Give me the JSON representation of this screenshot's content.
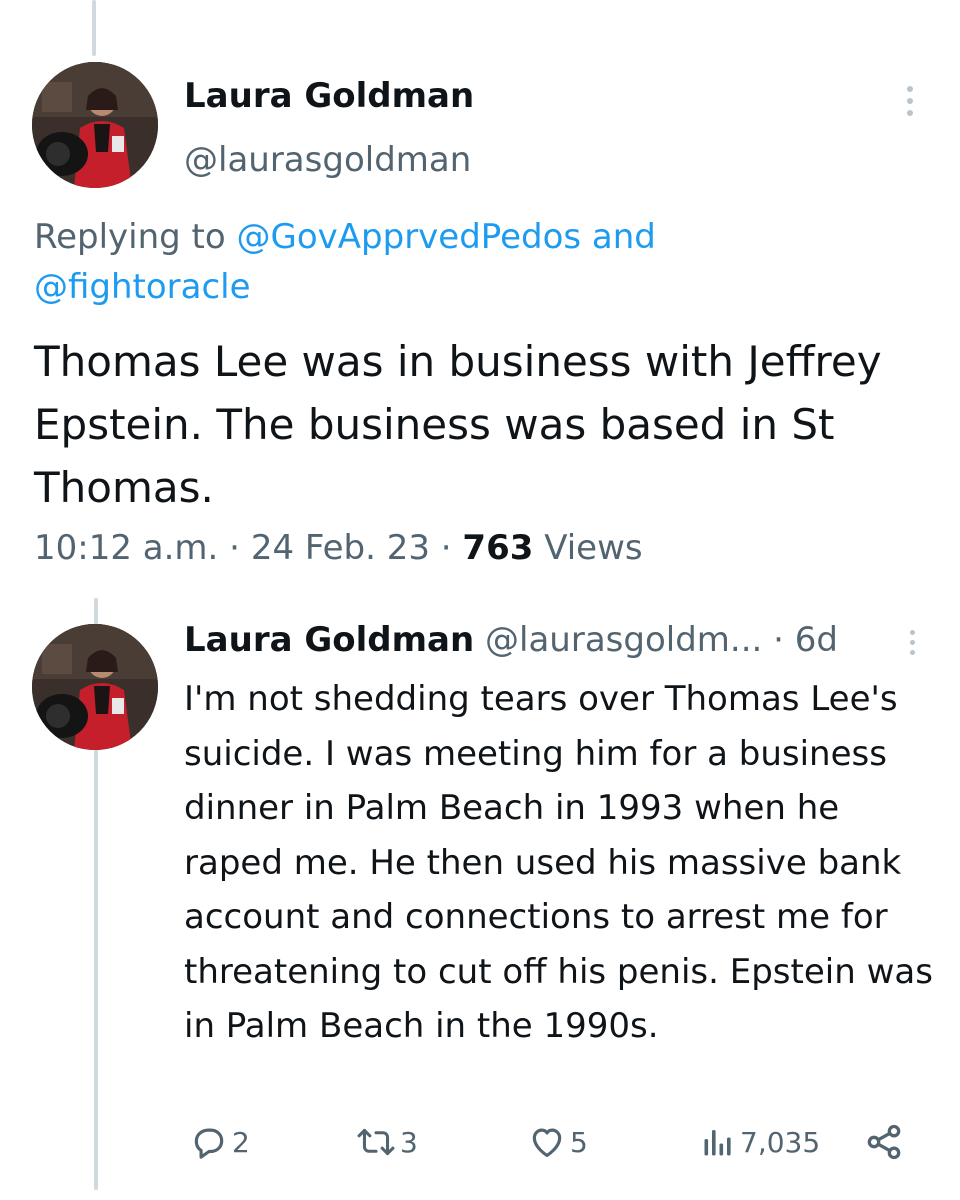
{
  "colors": {
    "link": "#1d9bf0",
    "secondary": "#536471",
    "text": "#0f1419"
  },
  "main_tweet": {
    "author_name": "Laura Goldman",
    "author_handle": "@laurasgoldman",
    "replying_prefix": "Replying to ",
    "replying_to_1": "@GovApprvedPedos",
    "replying_and": " and",
    "replying_to_2": "@fightoracle",
    "text": "Thomas Lee was in business with Jeffrey Epstein. The business was based in St Thomas.",
    "time": "10:12 a.m.",
    "sep1": " · ",
    "date": "24 Feb. 23",
    "sep2": " · ",
    "views_count": "763",
    "views_label": " Views"
  },
  "reply_tweet": {
    "author_name": "Laura Goldman",
    "author_handle": "@laurasgoldm...",
    "age": " · 6d",
    "text": "I'm not shedding tears over Thomas Lee's suicide. I was meeting him for a business dinner in Palm Beach in 1993 when he raped me. He then used his massive bank account and connections to arrest me for threatening to cut off his penis. Epstein was in Palm Beach in the 1990s.",
    "actions": {
      "replies": "2",
      "retweets": "3",
      "likes": "5",
      "views": "7,035"
    }
  },
  "icons": [
    "more-icon",
    "reply-icon",
    "retweet-icon",
    "like-icon",
    "views-icon",
    "share-icon"
  ]
}
